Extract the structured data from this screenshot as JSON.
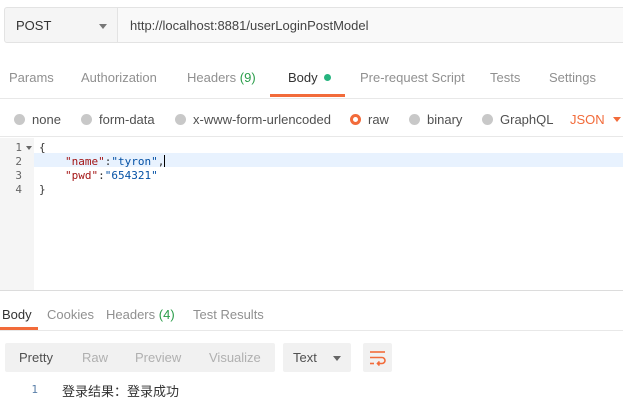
{
  "request": {
    "method": "POST",
    "url": "http://localhost:8881/userLoginPostModel"
  },
  "tabs": [
    {
      "label": "Params"
    },
    {
      "label": "Authorization"
    },
    {
      "label": "Headers",
      "count": "(9)"
    },
    {
      "label": "Body"
    },
    {
      "label": "Pre-request Script"
    },
    {
      "label": "Tests"
    },
    {
      "label": "Settings"
    }
  ],
  "body_types": {
    "none": "none",
    "form_data": "form-data",
    "urlencoded": "x-www-form-urlencoded",
    "raw": "raw",
    "binary": "binary",
    "graphql": "GraphQL",
    "selected": "raw"
  },
  "format": "JSON",
  "editor": {
    "lines": [
      "1",
      "2",
      "3",
      "4"
    ],
    "open_brace": "{",
    "name_key": "\"name\"",
    "name_val": "\"tyron\"",
    "pwd_key": "\"pwd\"",
    "pwd_val": "\"654321\"",
    "close_brace": "}",
    "colon": ":",
    "comma": ","
  },
  "response": {
    "tabs": [
      {
        "label": "Body"
      },
      {
        "label": "Cookies"
      },
      {
        "label": "Headers",
        "count": "(4)"
      },
      {
        "label": "Test Results"
      }
    ],
    "views": [
      "Pretty",
      "Raw",
      "Preview",
      "Visualize"
    ],
    "active_view": "Pretty",
    "text_type": "Text",
    "line": "1",
    "content": "登录结果：登录成功"
  },
  "colors": {
    "accent": "#f26b3a",
    "success": "#26b47f"
  }
}
